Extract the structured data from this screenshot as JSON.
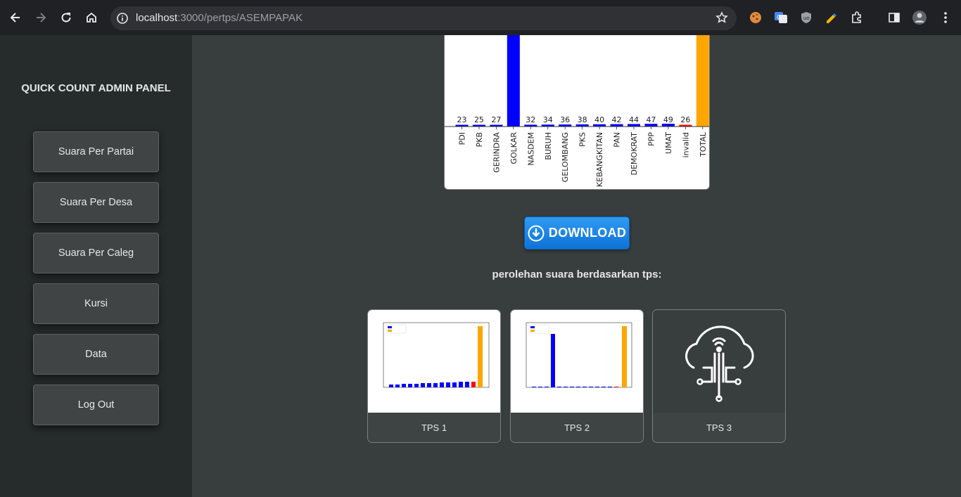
{
  "browser": {
    "url_host": "localhost",
    "url_path": ":3000/pertps/ASEMPAPAK"
  },
  "sidebar": {
    "title": "QUICK COUNT ADMIN PANEL",
    "items": [
      {
        "label": "Suara Per Partai"
      },
      {
        "label": "Suara Per Desa"
      },
      {
        "label": "Suara Per Caleg"
      },
      {
        "label": "Kursi"
      },
      {
        "label": "Data"
      },
      {
        "label": "Log Out"
      }
    ]
  },
  "main": {
    "download_label": "DOWNLOAD",
    "section_title": "perolehan suara berdasarkan tps:",
    "tps_cards": [
      {
        "label": "TPS 1"
      },
      {
        "label": "TPS 2"
      },
      {
        "label": "TPS 3"
      }
    ]
  },
  "colors": {
    "party": "#0000ff",
    "invalid": "#ff0000",
    "total": "#ffa500"
  },
  "chart_data": [
    {
      "type": "bar",
      "categories": [
        "PDI",
        "PKB",
        "GERINDRA",
        "GOLKAR",
        "NASDEM",
        "BURUH",
        "GELOMBANG",
        "PKS",
        "KEBANGKITAN",
        "PAN",
        "DEMOKRAT",
        "PPP",
        "UMAT",
        "invalid",
        "TOTAL"
      ],
      "values": [
        23,
        25,
        27,
        null,
        32,
        34,
        36,
        38,
        40,
        42,
        44,
        47,
        49,
        26,
        null
      ],
      "bar_colors": [
        "party",
        "party",
        "party",
        "party",
        "party",
        "party",
        "party",
        "party",
        "party",
        "party",
        "party",
        "party",
        "party",
        "invalid",
        "total"
      ]
    }
  ]
}
